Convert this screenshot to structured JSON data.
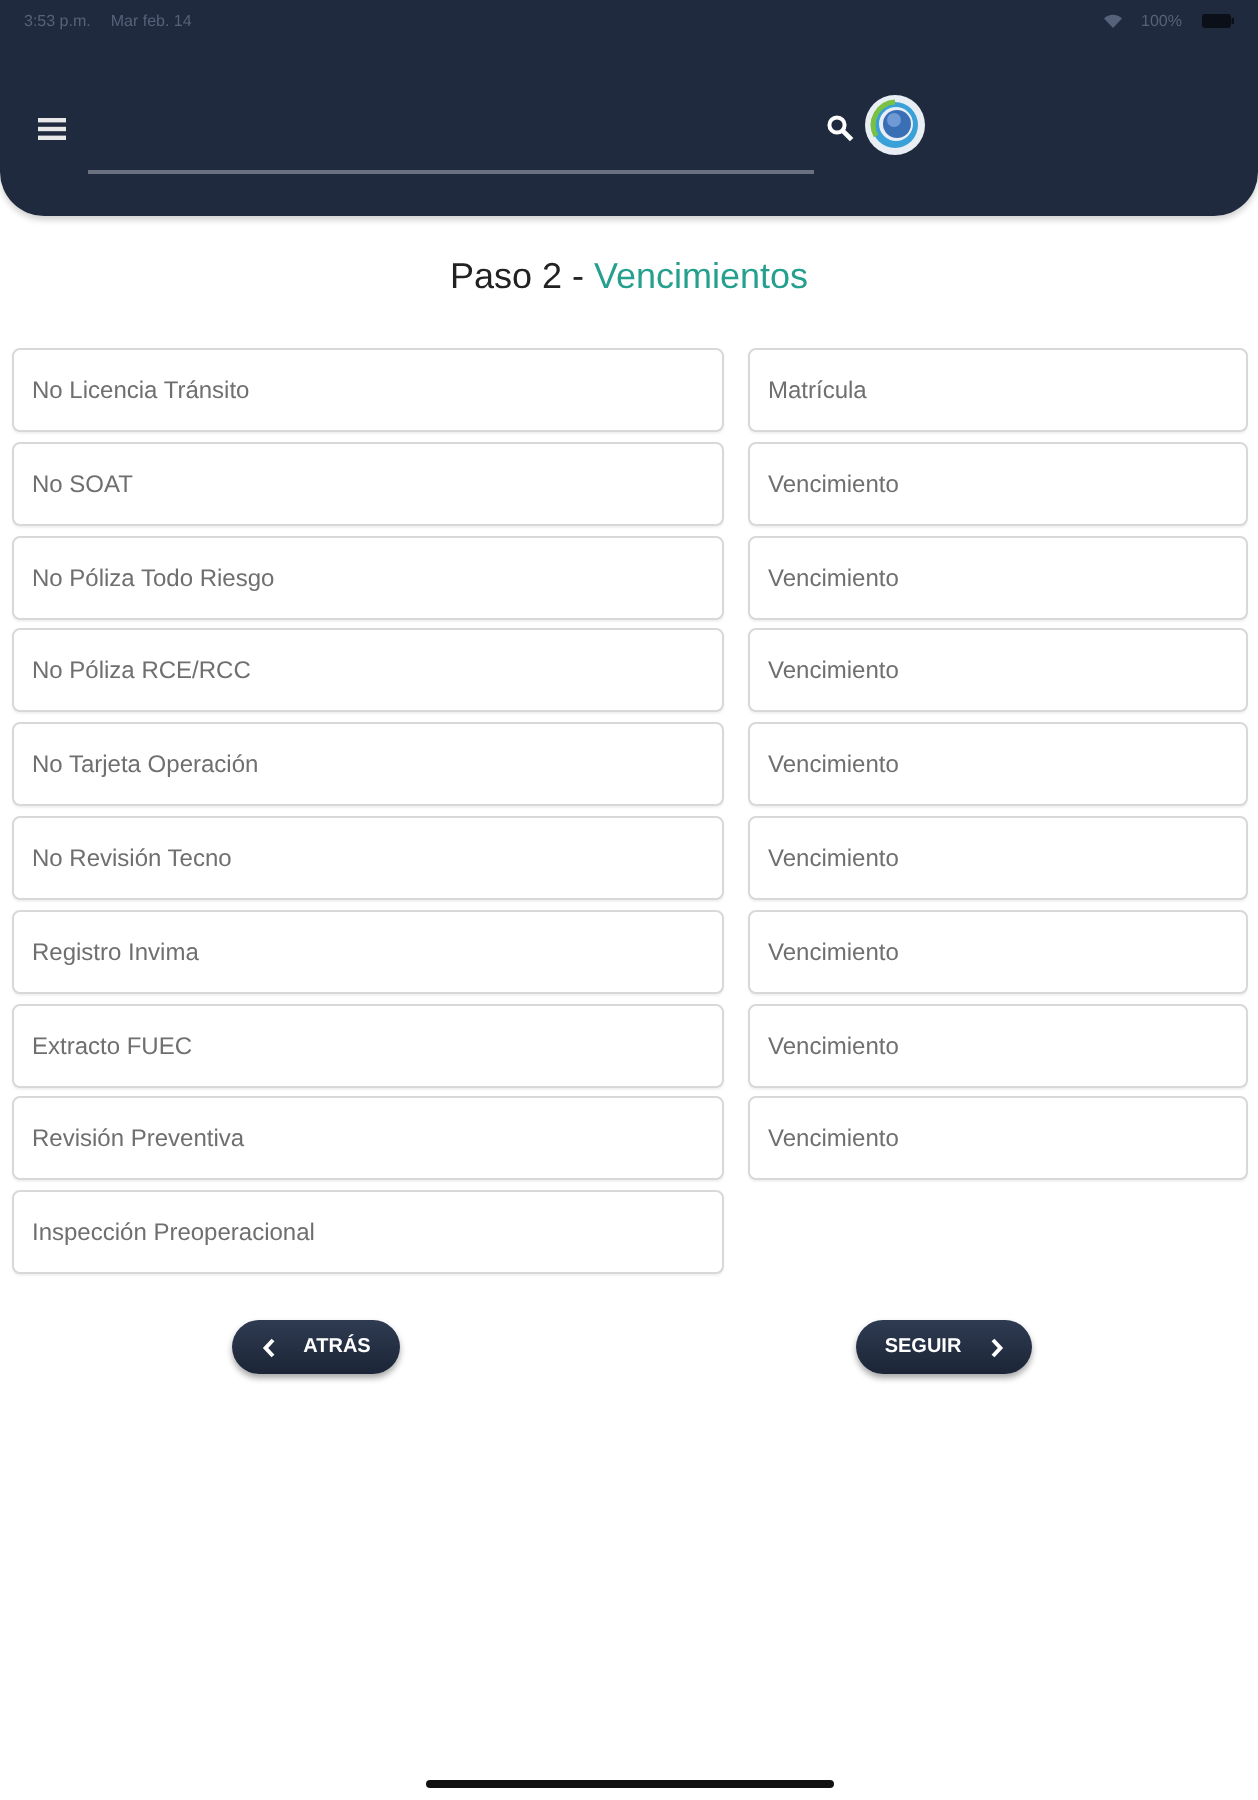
{
  "status_bar": {
    "time": "3:53 p.m.",
    "date": "Mar feb. 14",
    "battery": "100%"
  },
  "heading": {
    "step": "Paso 2 - ",
    "title": "Vencimientos"
  },
  "rows": [
    {
      "document": {
        "placeholder": "No Licencia Tránsito"
      },
      "expiry": {
        "placeholder": "Matrícula"
      }
    },
    {
      "document": {
        "placeholder": "No SOAT"
      },
      "expiry": {
        "placeholder": "Vencimiento"
      }
    },
    {
      "document": {
        "placeholder": "No Póliza Todo Riesgo"
      },
      "expiry": {
        "placeholder": "Vencimiento"
      }
    },
    {
      "document": {
        "placeholder": "No Póliza RCE/RCC"
      },
      "expiry": {
        "placeholder": "Vencimiento"
      }
    },
    {
      "document": {
        "placeholder": "No Tarjeta Operación"
      },
      "expiry": {
        "placeholder": "Vencimiento"
      }
    },
    {
      "document": {
        "placeholder": "No Revisión Tecno"
      },
      "expiry": {
        "placeholder": "Vencimiento"
      }
    },
    {
      "document": {
        "placeholder": "Registro Invima"
      },
      "expiry": {
        "placeholder": "Vencimiento"
      }
    },
    {
      "document": {
        "placeholder": "Extracto FUEC"
      },
      "expiry": {
        "placeholder": "Vencimiento"
      }
    },
    {
      "document": {
        "placeholder": "Revisión Preventiva"
      },
      "expiry": {
        "placeholder": "Vencimiento"
      }
    },
    {
      "document": {
        "placeholder": "Inspección Preoperacional"
      }
    }
  ],
  "buttons": [
    {
      "kind": "back",
      "label": "ATRÁS"
    },
    {
      "kind": "next",
      "label": "SEGUIR"
    }
  ]
}
